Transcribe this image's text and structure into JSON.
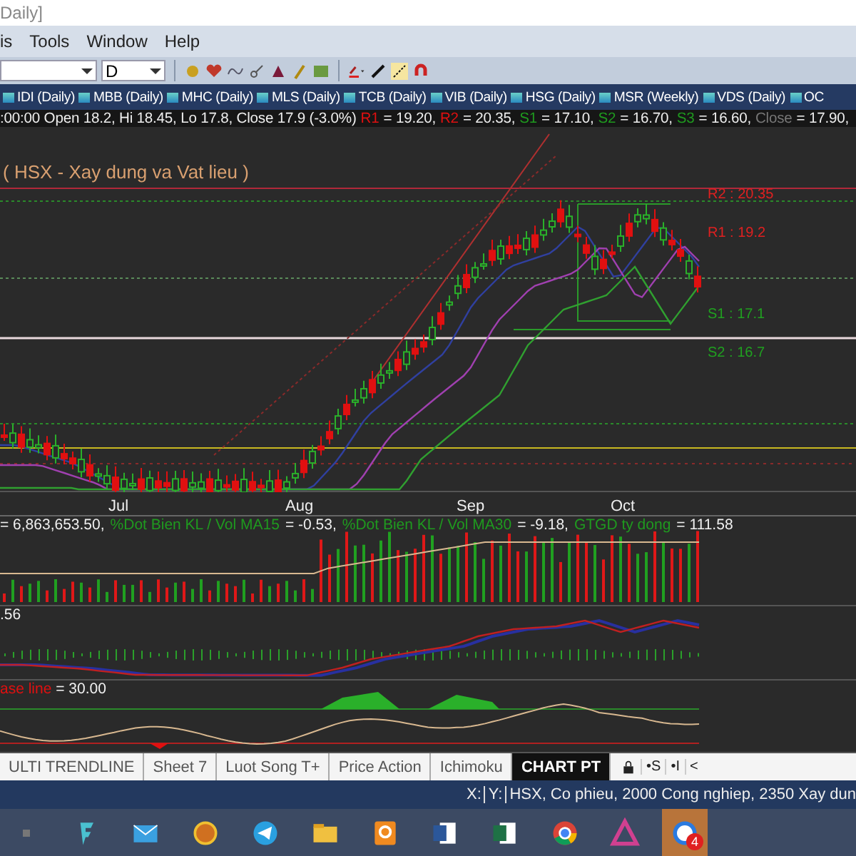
{
  "window": {
    "title": "Daily]"
  },
  "menu": [
    "is",
    "Tools",
    "Window",
    "Help"
  ],
  "toolbar": {
    "period": "D"
  },
  "symbol_tabs": [
    {
      "label": "IDI (Daily)"
    },
    {
      "label": "MBB (Daily)"
    },
    {
      "label": "MHC (Daily)"
    },
    {
      "label": "MLS (Daily)"
    },
    {
      "label": "TCB (Daily)"
    },
    {
      "label": "VIB (Daily)"
    },
    {
      "label": "HSG (Daily)"
    },
    {
      "label": "MSR (Weekly)"
    },
    {
      "label": "VDS (Daily)"
    },
    {
      "label": "OC"
    }
  ],
  "info_bar": {
    "ohlc": ":00:00 Open 18.2, Hi 18.45, Lo 17.8, Close 17.9 (-3.0%)",
    "levels": [
      {
        "name": "R1",
        "color": "#e01010",
        "value": "= 19.20,"
      },
      {
        "name": "R2",
        "color": "#e01010",
        "value": "= 20.35,"
      },
      {
        "name": "S1",
        "color": "#1f9a1f",
        "value": "= 17.10,"
      },
      {
        "name": "S2",
        "color": "#1f9a1f",
        "value": "= 16.70,"
      },
      {
        "name": "S3",
        "color": "#1f9a1f",
        "value": "= 16.60,"
      },
      {
        "name": "Close",
        "color": "#777777",
        "value": "= 17.90,"
      }
    ]
  },
  "price_pane": {
    "title": "( HSX  -  Xay dung va Vat lieu )",
    "levels": [
      {
        "label": "R2 : 20.35",
        "kind": "resistance"
      },
      {
        "label": "R1 : 19.2",
        "kind": "resistance"
      },
      {
        "label": "S1 : 17.1",
        "kind": "support"
      },
      {
        "label": "S2 : 16.7",
        "kind": "support"
      }
    ]
  },
  "date_axis": [
    "Jul",
    "Aug",
    "Sep",
    "Oct"
  ],
  "volume_pane": {
    "segments": [
      {
        "text": "= 6,863,653.50,",
        "kind": "value"
      },
      {
        "text": "%Dot Bien KL / Vol MA15",
        "kind": "name"
      },
      {
        "text": "= -0.53,",
        "kind": "value"
      },
      {
        "text": "%Dot Bien KL / Vol MA30",
        "kind": "name"
      },
      {
        "text": "= -9.18,",
        "kind": "value"
      },
      {
        "text": "GTGD ty dong",
        "kind": "name"
      },
      {
        "text": "= 111.58",
        "kind": "value"
      }
    ]
  },
  "macd_pane": {
    "reading": ".56"
  },
  "rsi_pane": {
    "label": "ase line",
    "reading": "= 30.00"
  },
  "sheet_tabs": [
    {
      "label": "ULTI TRENDLINE",
      "selected": false
    },
    {
      "label": "Sheet 7",
      "selected": false
    },
    {
      "label": "Luot Song T+",
      "selected": false
    },
    {
      "label": "Price Action",
      "selected": false
    },
    {
      "label": "Ichimoku",
      "selected": false
    },
    {
      "label": "CHART PT",
      "selected": true
    }
  ],
  "sheet_buttons": [
    "•S",
    "•I",
    "<"
  ],
  "status_bar": {
    "x_label": "X:",
    "y_label": "Y:",
    "text": "HSX, Co phieu, 2000 Cong nghiep, 2350 Xay dun"
  },
  "taskbar": [
    {
      "kind": "generic",
      "active": false
    },
    {
      "kind": "f-app",
      "active": false
    },
    {
      "kind": "mail",
      "active": false
    },
    {
      "kind": "gear-app",
      "active": false
    },
    {
      "kind": "telegram",
      "active": false
    },
    {
      "kind": "folder",
      "active": false
    },
    {
      "kind": "orange-app",
      "active": false
    },
    {
      "kind": "word",
      "active": false
    },
    {
      "kind": "excel",
      "active": false
    },
    {
      "kind": "chrome",
      "active": false
    },
    {
      "kind": "triangle",
      "active": false
    },
    {
      "kind": "chat",
      "active": true,
      "badge": "4"
    }
  ]
}
